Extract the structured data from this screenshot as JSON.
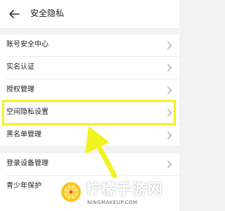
{
  "header": {
    "title": "安全隐私",
    "back_icon": "back-arrow-icon"
  },
  "menu": [
    {
      "label": "账号安全中心"
    },
    {
      "label": "实名认证"
    },
    {
      "label": "授权管理"
    },
    {
      "label": "空间隐私设置",
      "highlighted": true
    },
    {
      "label": "黑名单管理"
    },
    {
      "label": "登录设备管理"
    },
    {
      "label": "青少年保护"
    }
  ],
  "annotation": {
    "highlight_color": "#f2f21e",
    "arrow_color": "#f2f21e"
  },
  "watermark": {
    "brand": "柠檬手游网",
    "url": "NINGMAKEUP.COM"
  }
}
